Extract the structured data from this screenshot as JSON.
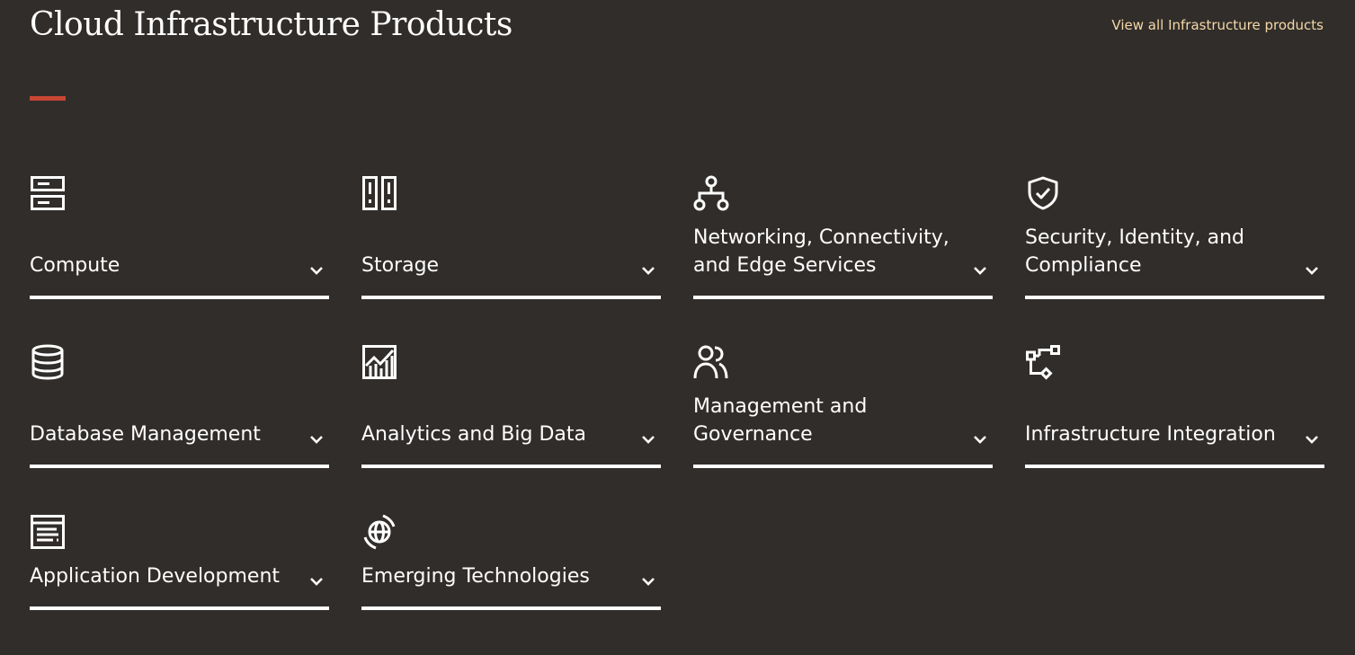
{
  "header": {
    "title": "Cloud Infrastructure Products",
    "view_all_link": "View all Infrastructure products"
  },
  "colors": {
    "background": "#312d2a",
    "accent": "#c74634",
    "link": "#f4d8a8",
    "text": "#ffffff"
  },
  "tiles": [
    {
      "label": "Compute",
      "icon": "server-icon"
    },
    {
      "label": "Storage",
      "icon": "storage-icon"
    },
    {
      "label": "Networking, Connectivity, and Edge Services",
      "icon": "network-icon"
    },
    {
      "label": "Security, Identity, and Compliance",
      "icon": "shield-check-icon"
    },
    {
      "label": "Database Management",
      "icon": "database-icon"
    },
    {
      "label": "Analytics and Big Data",
      "icon": "chart-icon"
    },
    {
      "label": "Management and Governance",
      "icon": "people-icon"
    },
    {
      "label": "Infrastructure Integration",
      "icon": "integration-icon"
    },
    {
      "label": "Application Development",
      "icon": "app-window-icon"
    },
    {
      "label": "Emerging Technologies",
      "icon": "globe-icon"
    }
  ]
}
